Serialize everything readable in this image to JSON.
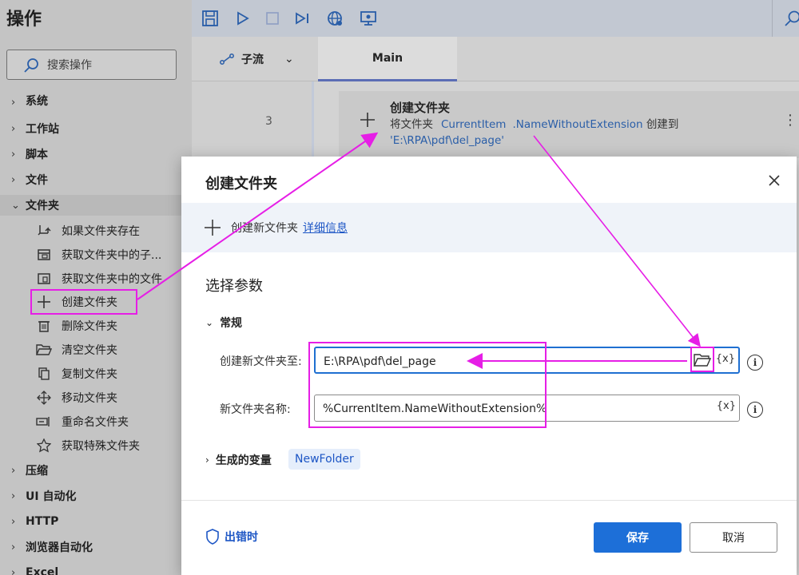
{
  "left_panel": {
    "title": "操作",
    "search_placeholder": "搜索操作",
    "categories_top": [
      {
        "label": "系统"
      },
      {
        "label": "工作站"
      },
      {
        "label": "脚本"
      },
      {
        "label": "文件"
      },
      {
        "label": "文件夹"
      }
    ],
    "folder_actions": [
      {
        "label": "如果文件夹存在",
        "icon": "branch-icon"
      },
      {
        "label": "获取文件夹中的子...",
        "icon": "folder-tree-icon"
      },
      {
        "label": "获取文件夹中的文件",
        "icon": "folder-files-icon"
      },
      {
        "label": "创建文件夹",
        "icon": "plus-icon"
      },
      {
        "label": "删除文件夹",
        "icon": "trash-icon"
      },
      {
        "label": "清空文件夹",
        "icon": "folder-open-icon"
      },
      {
        "label": "复制文件夹",
        "icon": "copy-icon"
      },
      {
        "label": "移动文件夹",
        "icon": "move-icon"
      },
      {
        "label": "重命名文件夹",
        "icon": "rename-icon"
      },
      {
        "label": "获取特殊文件夹",
        "icon": "star-icon"
      }
    ],
    "categories_bottom": [
      {
        "label": "压缩"
      },
      {
        "label": "UI 自动化"
      },
      {
        "label": "HTTP"
      },
      {
        "label": "浏览器自动化"
      },
      {
        "label": "Excel"
      }
    ]
  },
  "tabs": {
    "subflow": "子流",
    "main": "Main"
  },
  "step": {
    "line_number": "3",
    "title": "创建文件夹",
    "desc_prefix": "将文件夹",
    "var_name": "CurrentItem",
    "var_prop": ".NameWithoutExtension",
    "desc_mid": " 创建到 ",
    "path": "'E:\\RPA\\pdf\\del_page'"
  },
  "dialog": {
    "title": "创建文件夹",
    "info_text": "创建新文件夹",
    "info_link": "详细信息",
    "section_title": "选择参数",
    "general_label": "常规",
    "param1_label": "创建新文件夹至:",
    "param1_value": "E:\\RPA\\pdf\\del_page",
    "param2_label": "新文件夹名称:",
    "param2_value": "%CurrentItem.NameWithoutExtension%",
    "var_button": "{x}",
    "info_glyph": "i",
    "vars_label": "生成的变量",
    "var_chip": "NewFolder",
    "on_error": "出错时",
    "save": "保存",
    "cancel": "取消"
  },
  "colors": {
    "accent": "#1d6fd8",
    "annotation": "#e61ee6",
    "link": "#1d56c5"
  }
}
